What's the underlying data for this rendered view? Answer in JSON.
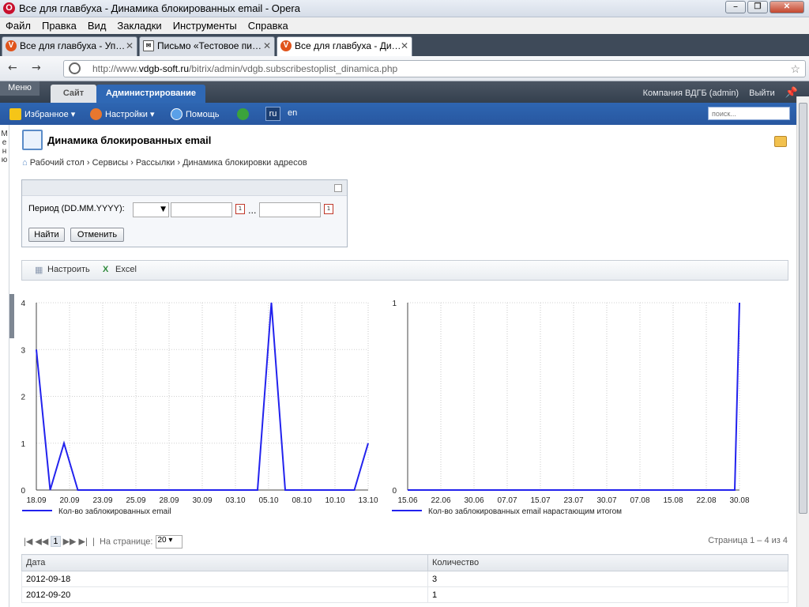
{
  "window": {
    "title": "Все для главбуха - Динамика блокированных email - Opera"
  },
  "menu": [
    "Файл",
    "Правка",
    "Вид",
    "Закладки",
    "Инструменты",
    "Справка"
  ],
  "tabs": [
    {
      "label": "Все для главбуха - Уп…"
    },
    {
      "label": "Письмо «Тестовое пи…"
    },
    {
      "label": "Все для главбуха - Ди…"
    }
  ],
  "address": {
    "prefix": "http://www.",
    "host": "vdgb-soft.ru",
    "path": "/bitrix/admin/vdgb.subscribestoplist_dinamica.php"
  },
  "panel": {
    "menu_label": "Меню",
    "site_tab": "Сайт",
    "admin_tab": "Администрирование",
    "user": "Компания ВДГБ (admin)",
    "logout": "Выйти",
    "favorites": "Избранное",
    "settings": "Настройки",
    "help": "Помощь",
    "lang_ru": "ru",
    "lang_en": "en",
    "search_placeholder": "поиск..."
  },
  "sidebar_label": "Меню",
  "page": {
    "title": "Динамика блокированных email",
    "breadcrumbs": [
      "Рабочий стол",
      "Сервисы",
      "Рассылки",
      "Динамика блокировки адресов"
    ]
  },
  "filter": {
    "period_label": "Период (DD.MM.YYYY):",
    "dots": "...",
    "find": "Найти",
    "cancel": "Отменить"
  },
  "toolbar": {
    "configure": "Настроить",
    "excel": "Excel"
  },
  "chart_data": [
    {
      "type": "line",
      "x": [
        "18.09",
        "19.09",
        "20.09",
        "21.09",
        "22.09",
        "23.09",
        "24.09",
        "25.09",
        "26.09",
        "27.09",
        "28.09",
        "29.09",
        "30.09",
        "01.10",
        "02.10",
        "03.10",
        "04.10",
        "05.10",
        "06.10",
        "07.10",
        "08.10",
        "09.10",
        "10.10",
        "11.10",
        "12.10"
      ],
      "tick_labels": [
        "18.09",
        "20.09",
        "23.09",
        "25.09",
        "28.09",
        "30.09",
        "03.10",
        "05.10",
        "08.10",
        "10.10",
        "13.10"
      ],
      "series": [
        {
          "name": "Кол-во заблокированных email",
          "values": [
            3,
            0,
            1,
            0,
            0,
            0,
            0,
            0,
            0,
            0,
            0,
            0,
            0,
            0,
            0,
            0,
            0,
            4,
            0,
            0,
            0,
            0,
            0,
            0,
            1
          ]
        }
      ],
      "ylim": [
        0,
        4
      ],
      "yticks": [
        0,
        1,
        2,
        3,
        4
      ],
      "grid": true,
      "legend": "bottom-left",
      "color": "#2222ee"
    },
    {
      "type": "line",
      "x": [
        "15.06",
        "29.08",
        "30.08"
      ],
      "tick_labels": [
        "15.06",
        "22.06",
        "30.06",
        "07.07",
        "15.07",
        "23.07",
        "30.07",
        "07.08",
        "15.08",
        "22.08",
        "30.08"
      ],
      "series": [
        {
          "name": "Кол-во заблокированных email нарастающим итогом",
          "values": [
            0,
            0,
            1
          ]
        }
      ],
      "ylim": [
        0,
        1
      ],
      "yticks": [
        0,
        1
      ],
      "grid": true,
      "legend": "bottom-left",
      "color": "#2222ee"
    }
  ],
  "pager": {
    "per_page_label": "На странице:",
    "per_page": "20",
    "current": "1",
    "info": "Страница 1 – 4 из 4"
  },
  "table": {
    "columns": [
      "Дата",
      "Количество"
    ],
    "rows": [
      [
        "2012-09-18",
        "3"
      ],
      [
        "2012-09-20",
        "1"
      ]
    ]
  }
}
